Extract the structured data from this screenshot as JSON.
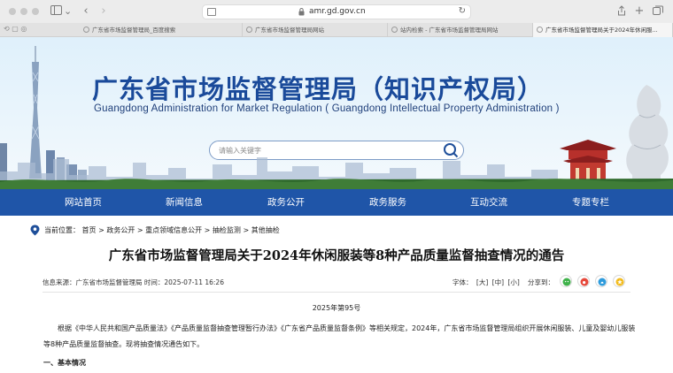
{
  "browser": {
    "address": "amr.gd.gov.cn",
    "tabs": [
      {
        "label": "广东省市场监督管理局_百度搜索"
      },
      {
        "label": "广东省市场监督管理局网站"
      },
      {
        "label": "站内检索 - 广东省市场监督管理局网站"
      },
      {
        "label": "广东省市场监督管理局关于2024年休闲服..."
      }
    ]
  },
  "banner": {
    "title": "广东省市场监督管理局（知识产权局）",
    "subtitle": "Guangdong Administration for Market Regulation ( Guangdong Intellectual Property Administration )",
    "search_placeholder": "请输入关键字"
  },
  "nav": {
    "items": [
      {
        "label": "网站首页"
      },
      {
        "label": "新闻信息"
      },
      {
        "label": "政务公开"
      },
      {
        "label": "政务服务"
      },
      {
        "label": "互动交流"
      },
      {
        "label": "专题专栏"
      }
    ]
  },
  "breadcrumb": {
    "text": "当前位置：  首页 > 政务公开 > 重点领域信息公开 > 抽检监测 > 其他抽检"
  },
  "article": {
    "title": "广东省市场监督管理局关于2024年休闲服装等8种产品质量监督抽查情况的通告",
    "meta": "信息来源：广东省市场监督管理局   时间：2025-07-11 16:26",
    "font_label": "字体：",
    "font_large": "[大]",
    "font_medium": "[中]",
    "font_small": "[小]",
    "share_label": "分享到：",
    "doc_no": "2025年第95号",
    "paragraph": "根据《中华人民共和国产品质量法》《产品质量监督抽查管理暂行办法》《广东省产品质量监督条例》等相关规定，2024年，广东省市场监督管理局组织开展休闲服装、儿童及婴幼儿服装等8种产品质量监督抽查。现将抽查情况通告如下。",
    "section": "一、基本情况"
  },
  "colors": {
    "nav_bg": "#1f55a8",
    "title_blue": "#1a4a9a"
  }
}
